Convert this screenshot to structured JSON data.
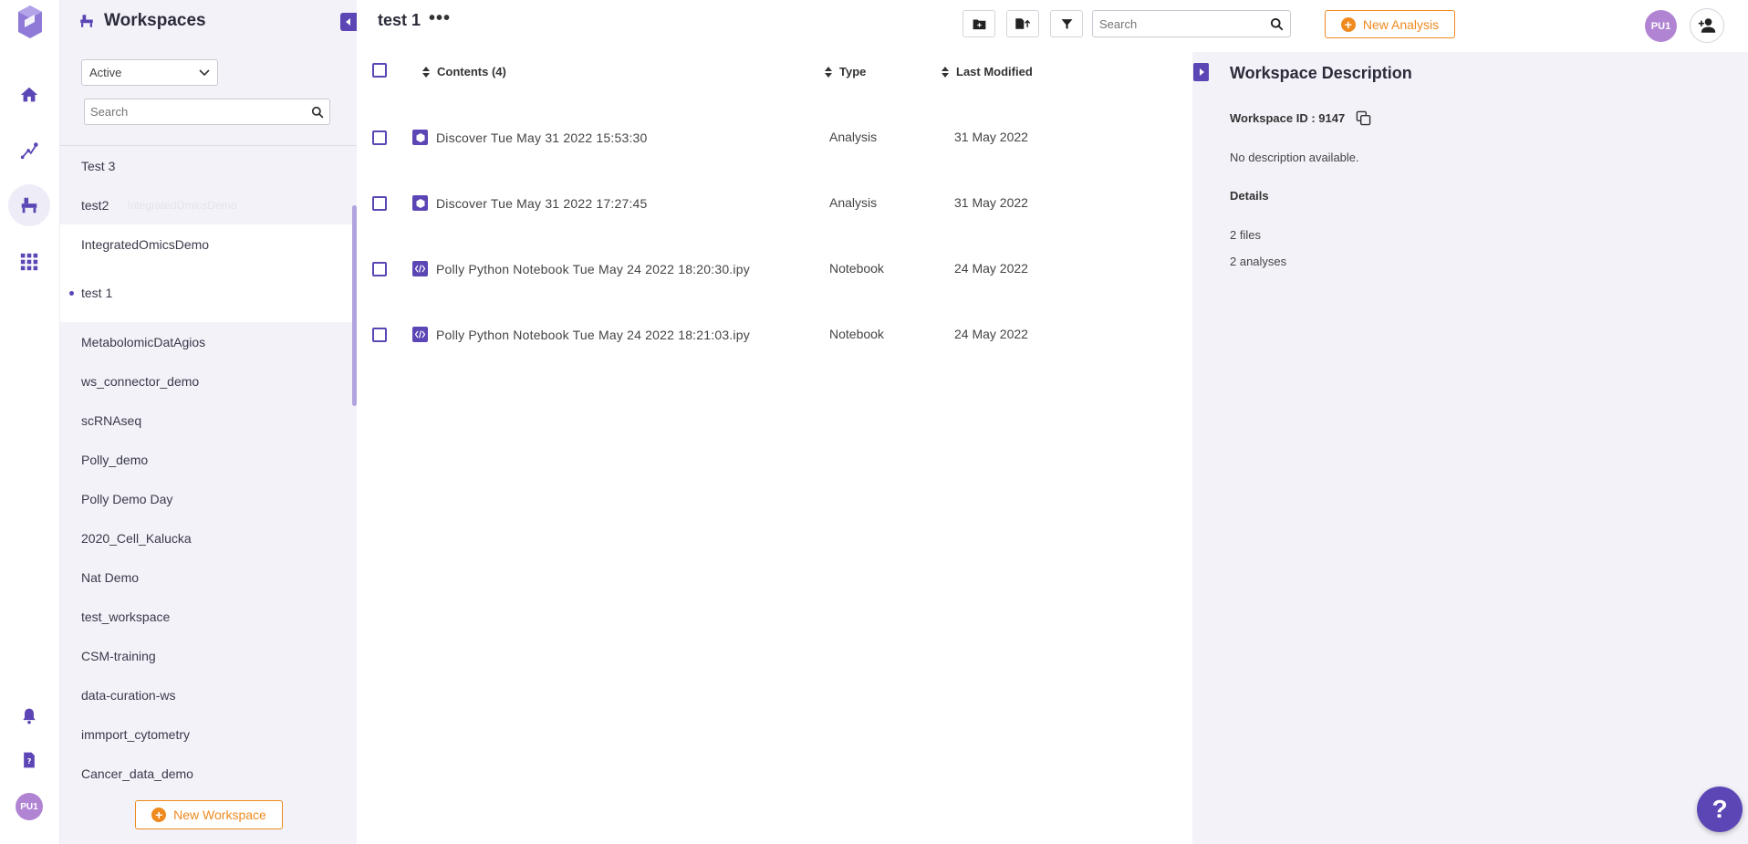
{
  "sidebar": {
    "workspaces_title": "Workspaces",
    "status_selected": "Active",
    "search_placeholder": "Search",
    "items": [
      {
        "label": "Test 3"
      },
      {
        "label": "test2"
      },
      {
        "label": "IntegratedOmicsDemo"
      },
      {
        "label": "test 1"
      },
      {
        "label": "MetabolomicDatAgios"
      },
      {
        "label": "ws_connector_demo"
      },
      {
        "label": "scRNAseq"
      },
      {
        "label": "Polly_demo"
      },
      {
        "label": "Polly Demo Day"
      },
      {
        "label": "2020_Cell_Kalucka"
      },
      {
        "label": "Nat Demo"
      },
      {
        "label": "test_workspace"
      },
      {
        "label": "CSM-training"
      },
      {
        "label": "data-curation-ws"
      },
      {
        "label": "immport_cytometry"
      },
      {
        "label": "Cancer_data_demo"
      }
    ],
    "drag_ghost_label": "IntegratedOmicsDemo",
    "new_workspace_label": "New Workspace",
    "user_initials": "PU1"
  },
  "header": {
    "workspace_name": "test 1",
    "more_label": "•••",
    "search_placeholder": "Search",
    "new_analysis_label": "New Analysis",
    "user_initials": "PU1"
  },
  "table": {
    "col_contents": "Contents (4)",
    "col_type": "Type",
    "col_modified": "Last Modified",
    "rows": [
      {
        "name": "Discover Tue May 31 2022 15:53:30",
        "type": "Analysis",
        "modified": "31 May 2022",
        "icon": "analysis-icon"
      },
      {
        "name": "Discover Tue May 31 2022 17:27:45",
        "type": "Analysis",
        "modified": "31 May 2022",
        "icon": "analysis-icon"
      },
      {
        "name": "Polly Python Notebook Tue May 24 2022 18:20:30.ipy",
        "type": "Notebook",
        "modified": "24 May 2022",
        "icon": "notebook-icon"
      },
      {
        "name": "Polly Python Notebook Tue May 24 2022 18:21:03.ipy",
        "type": "Notebook",
        "modified": "24 May 2022",
        "icon": "notebook-icon"
      }
    ]
  },
  "description": {
    "title": "Workspace Description",
    "workspace_id": "Workspace ID : 9147",
    "no_description": "No description available.",
    "details_label": "Details",
    "files": "2 files",
    "analyses": "2 analyses"
  },
  "help_label": "?",
  "colors": {
    "primary": "#5c46b5",
    "accent": "#ef8a1f",
    "panel_bg": "#f3f2f9",
    "avatar": "#b184d3"
  }
}
